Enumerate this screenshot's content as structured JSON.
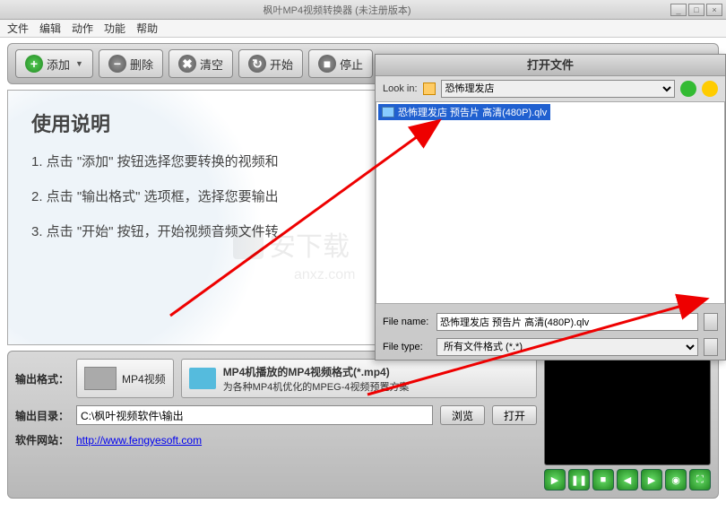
{
  "title": "枫叶MP4视频转换器    (未注册版本)",
  "menu": [
    "文件",
    "编辑",
    "动作",
    "功能",
    "帮助"
  ],
  "toolbar": {
    "add": "添加",
    "del": "删除",
    "clear": "清空",
    "start": "开始",
    "stop": "停止"
  },
  "instructions": {
    "heading": "使用说明",
    "s1": "1. 点击 \"添加\" 按钮选择您要转换的视频和",
    "s2": "2. 点击 \"输出格式\" 选项框，选择您要输出",
    "s3": "3. 点击 \"开始\" 按钮，开始视频音频文件转"
  },
  "output": {
    "format_label": "输出格式：",
    "format_name": "MP4视频",
    "format_title": "MP4机播放的MP4视频格式(*.mp4)",
    "format_desc": "为各种MP4机优化的MPEG-4视频预置方案",
    "dir_label": "输出目录：",
    "dir_value": "C:\\枫叶视频软件\\输出",
    "browse": "浏览",
    "open": "打开",
    "site_label": "软件网站：",
    "site_url": "http://www.fengyesoft.com"
  },
  "dialog": {
    "title": "打开文件",
    "lookin_label": "Look in:",
    "lookin_value": "恐怖理发店",
    "file_item": "恐怖理发店 预告片 高清(480P).qlv",
    "filename_label": "File name:",
    "filename_value": "恐怖理发店 预告片 高清(480P).qlv",
    "filetype_label": "File type:",
    "filetype_value": "所有文件格式 (*.*)"
  },
  "watermark": "安下载",
  "watermark_url": "anxz.com"
}
